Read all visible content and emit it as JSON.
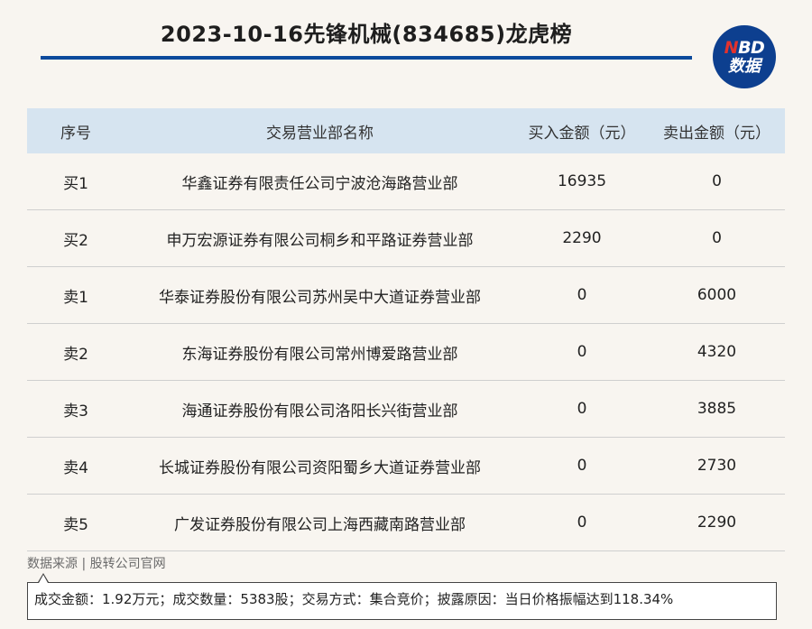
{
  "header": {
    "title": "2023-10-16先锋机械(834685)龙虎榜",
    "logo_top": "BD",
    "logo_top_accent": "N",
    "logo_bottom": "数据"
  },
  "table": {
    "columns": [
      "序号",
      "交易营业部名称",
      "买入金额（元）",
      "卖出金额（元）"
    ],
    "rows": [
      {
        "seq": "买1",
        "name": "华鑫证券有限责任公司宁波沧海路营业部",
        "buy": "16935",
        "sell": "0"
      },
      {
        "seq": "买2",
        "name": "申万宏源证券有限公司桐乡和平路证券营业部",
        "buy": "2290",
        "sell": "0"
      },
      {
        "seq": "卖1",
        "name": "华泰证券股份有限公司苏州吴中大道证券营业部",
        "buy": "0",
        "sell": "6000"
      },
      {
        "seq": "卖2",
        "name": "东海证券股份有限公司常州博爱路营业部",
        "buy": "0",
        "sell": "4320"
      },
      {
        "seq": "卖3",
        "name": "海通证券股份有限公司洛阳长兴街营业部",
        "buy": "0",
        "sell": "3885"
      },
      {
        "seq": "卖4",
        "name": "长城证券股份有限公司资阳蜀乡大道证券营业部",
        "buy": "0",
        "sell": "2730"
      },
      {
        "seq": "卖5",
        "name": "广发证券股份有限公司上海西藏南路营业部",
        "buy": "0",
        "sell": "2290"
      }
    ]
  },
  "footer": {
    "source": "数据来源 | 股转公司官网",
    "info": "成交金额：1.92万元；成交数量：5383股；交易方式：集合竞价；披露原因：当日价格振幅达到118.34%"
  },
  "colors": {
    "accent_blue": "#0c4a9c",
    "header_bg": "#d6e4f0",
    "logo_bg": "#0d3f8f",
    "logo_accent": "#e2322d"
  }
}
